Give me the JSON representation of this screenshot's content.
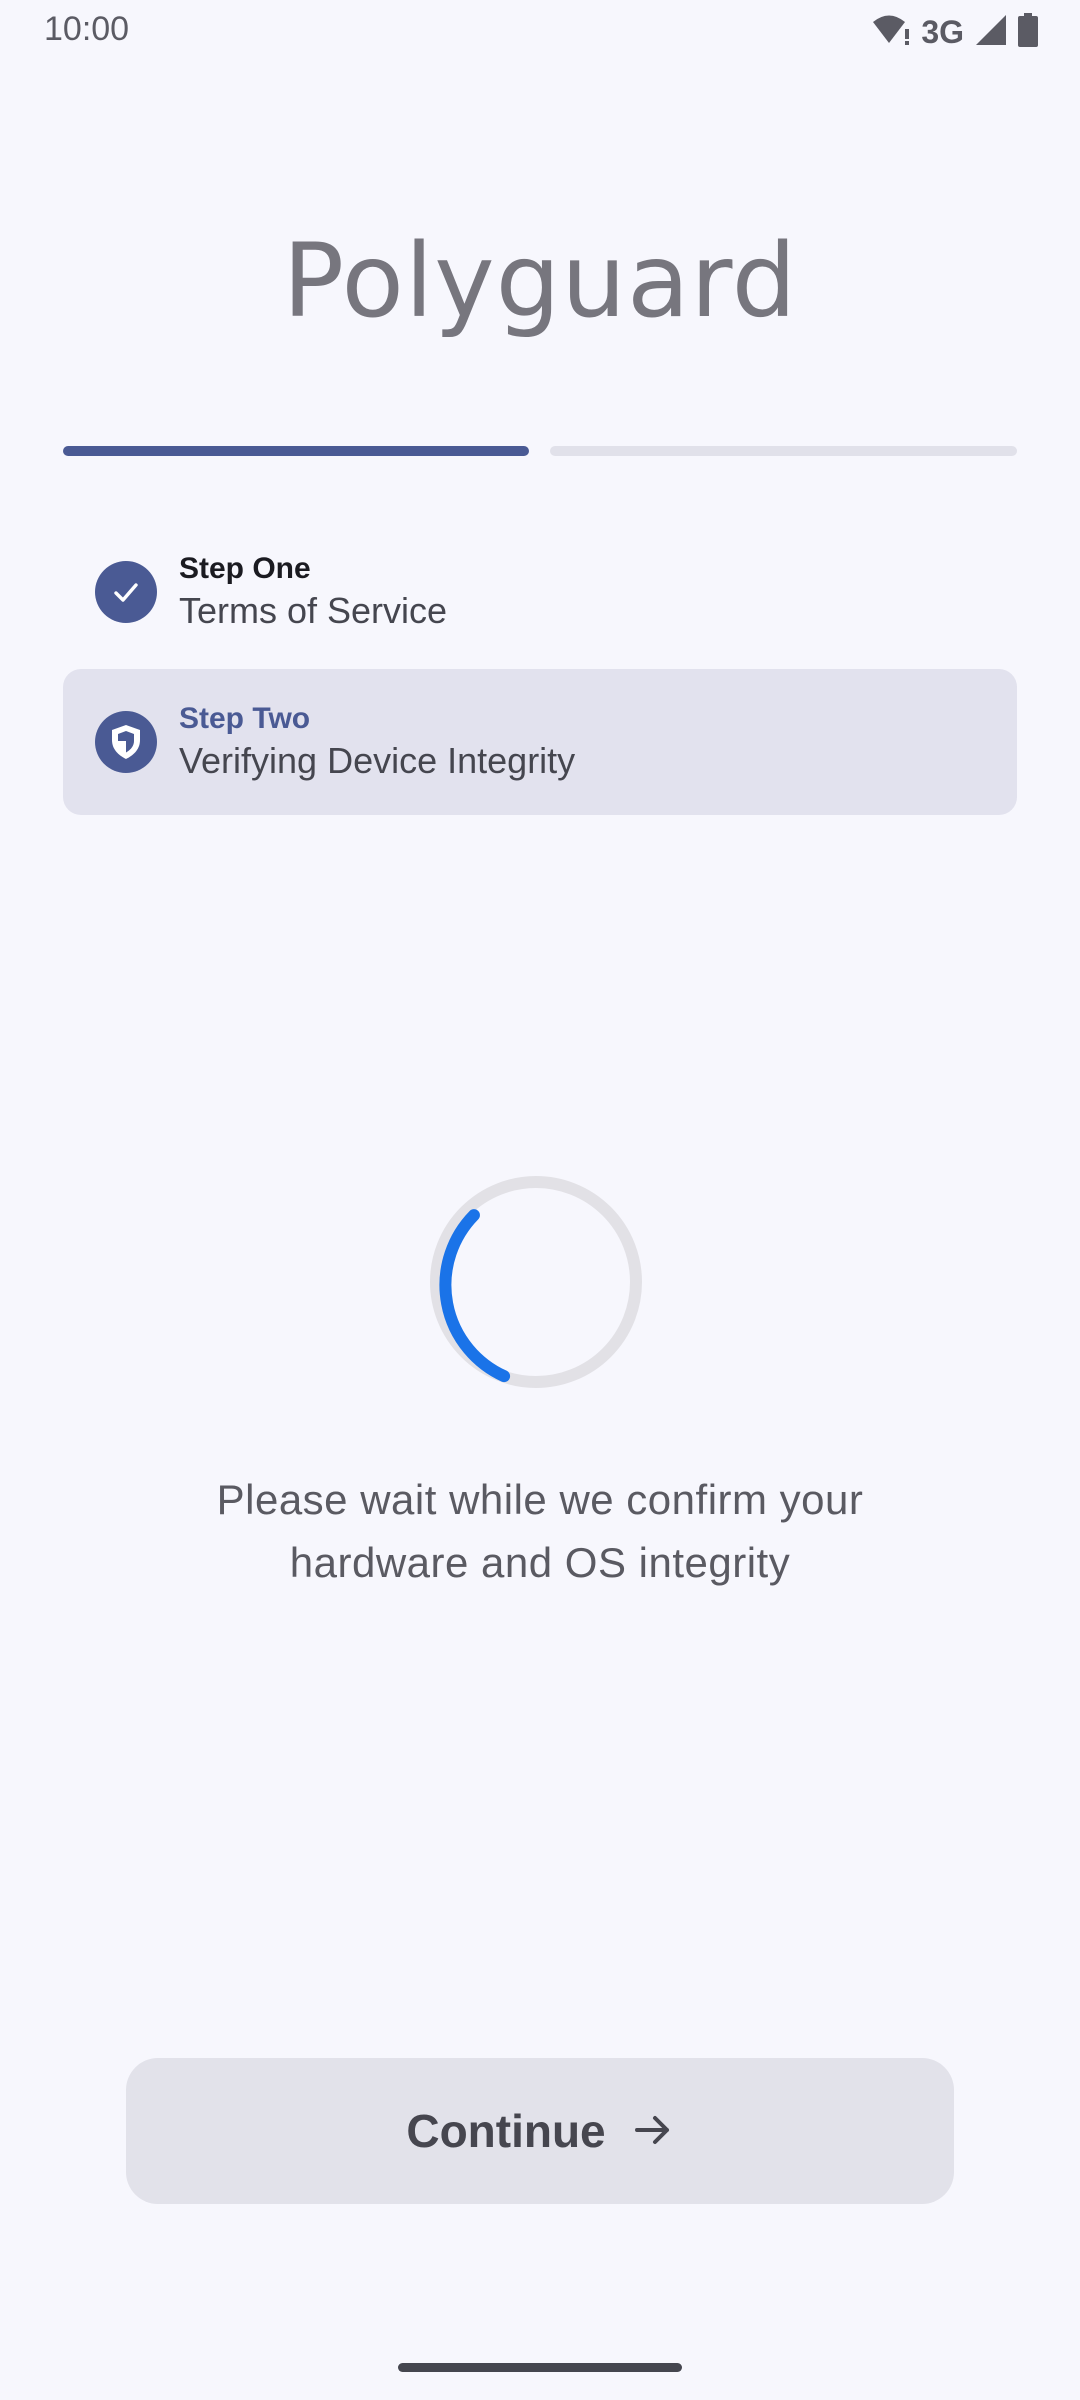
{
  "status_bar": {
    "time": "10:00",
    "network": "3G",
    "icons": [
      "wifi-alert-icon",
      "signal-icon",
      "battery-icon"
    ]
  },
  "app": {
    "title": "Polyguard"
  },
  "progress": {
    "total_steps": 2,
    "completed_steps": 1,
    "active_color": "#4a5a94",
    "inactive_color": "#e1e1ea"
  },
  "steps": [
    {
      "title": "Step One",
      "description": "Terms of Service",
      "state": "completed",
      "icon": "check-icon"
    },
    {
      "title": "Step Two",
      "description": "Verifying Device Integrity",
      "state": "active",
      "icon": "shield-icon"
    }
  ],
  "loading": {
    "message_line1": "Please wait while we confirm your",
    "message_line2": "hardware and OS integrity",
    "spinner_color": "#1a73e8"
  },
  "actions": {
    "continue_label": "Continue",
    "continue_icon": "arrow-right-icon"
  },
  "colors": {
    "background": "#f7f7fd",
    "accent": "#4a5a94",
    "active_step_bg": "#e2e2ee"
  }
}
